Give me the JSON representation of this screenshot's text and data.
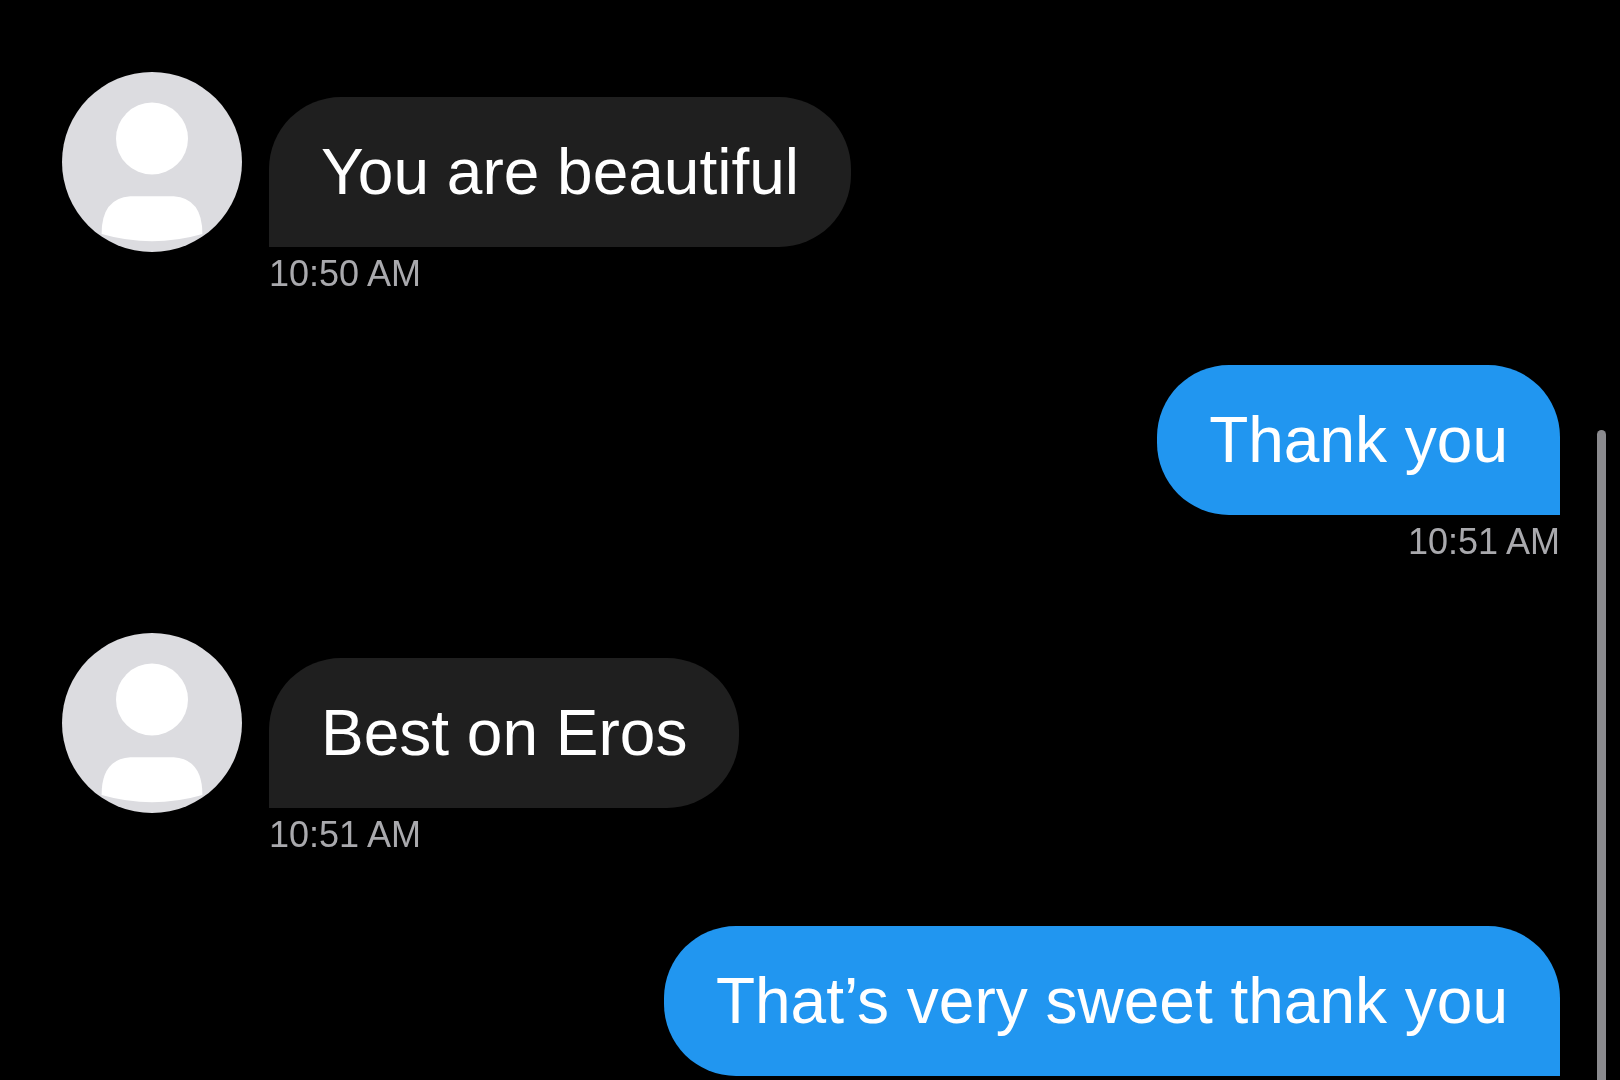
{
  "messages": [
    {
      "kind": "incoming",
      "text": "You are beautiful",
      "time": "10:50 AM"
    },
    {
      "kind": "outgoing",
      "text": "Thank you",
      "time": "10:51 AM"
    },
    {
      "kind": "incoming",
      "text": "Best on Eros",
      "time": "10:51 AM"
    },
    {
      "kind": "outgoing",
      "text": "That’s very sweet thank you"
    }
  ]
}
